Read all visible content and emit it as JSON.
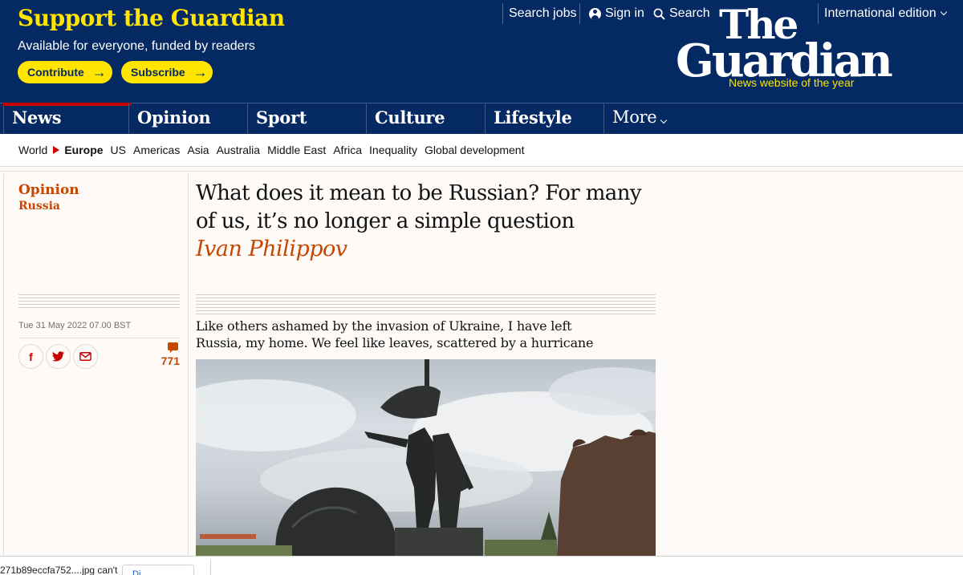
{
  "support": {
    "title": "Support the Guardian",
    "subtitle": "Available for everyone, funded by readers",
    "contribute_label": "Contribute",
    "subscribe_label": "Subscribe"
  },
  "topnav": {
    "jobs": "Search jobs",
    "signin": "Sign in",
    "search": "Search",
    "edition": "International edition"
  },
  "logo": {
    "the": "The",
    "guardian": "Guardian",
    "tagline": "News website of the year"
  },
  "pillars": [
    "News",
    "Opinion",
    "Sport",
    "Culture",
    "Lifestyle",
    "More"
  ],
  "subnav": {
    "items": [
      "World",
      "Europe",
      "US",
      "Americas",
      "Asia",
      "Australia",
      "Middle East",
      "Africa",
      "Inequality",
      "Global development"
    ],
    "current": "Europe"
  },
  "article": {
    "kicker": "Opinion",
    "kicker_sub": "Russia",
    "headline": "What does it mean to be Russian? For many of us, it’s no longer a simple question",
    "byline": "Ivan Philippov",
    "standfirst": "Like others ashamed by the invasion of Ukraine, I have left Russia, my home. We feel like leaves, scattered by a hurricane",
    "date": "Tue 31 May 2022 07.00 BST",
    "comment_count": "771"
  },
  "share": {
    "facebook": "f",
    "twitter": "twitter-icon",
    "email": "email-icon"
  },
  "statusbar": {
    "text": "271b89eccfa752....jpg can't",
    "button_label": "Di..."
  },
  "colors": {
    "brand_blue": "#052962",
    "brand_yellow": "#ffe500",
    "news_red": "#c70000",
    "opinion_orange": "#c74600",
    "page_bg": "#fdfaf7"
  }
}
